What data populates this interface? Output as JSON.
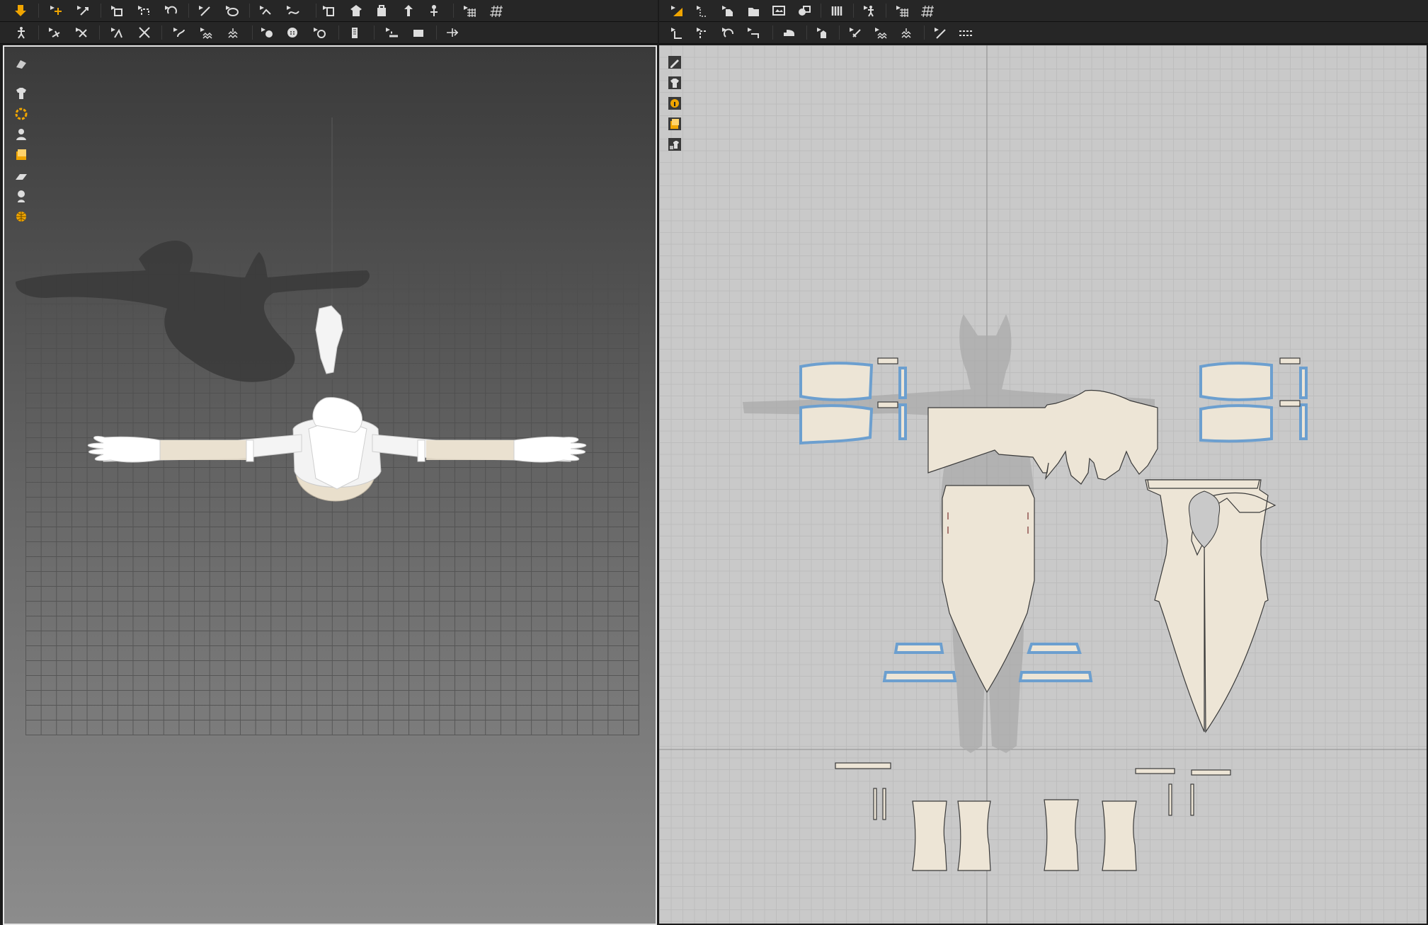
{
  "toolbar_left_row1": [
    "import-arrow-icon",
    "move-tool-icon",
    "transform-icon",
    "polygon-icon",
    "rectangle-icon",
    "circle-icon",
    "pen-icon",
    "curve-icon",
    "segment-icon",
    "fold-icon",
    "shirt-icon",
    "hanger-icon",
    "avatar-icon",
    "pin-icon",
    "grid-icon",
    "grid-alt-icon"
  ],
  "toolbar_right_row1": [
    "select-tool-icon",
    "edit-point-icon",
    "polygon-icon",
    "rectangle-icon",
    "ellipse-icon",
    "measure-icon",
    "columns-icon",
    "avatar-icon",
    "grid-icon",
    "grid-alt-icon"
  ],
  "colors": {
    "accent": "#f0a500",
    "panel_bg": "#262626",
    "fabric": "#ede5d6",
    "selected_outline": "#6c9fcf",
    "grid2d_bg": "#c9c9c9"
  },
  "view3d": {
    "side_tools": [
      "shaded-view-icon",
      "garment-icon",
      "texture-icon",
      "avatar-icon",
      "layer-icon",
      "surface-icon",
      "body-icon",
      "globe-icon"
    ]
  },
  "view2d": {
    "side_tools": [
      "pencil-icon",
      "garment-eye-icon",
      "info-icon",
      "layer-icon",
      "lock-garment-icon"
    ]
  }
}
